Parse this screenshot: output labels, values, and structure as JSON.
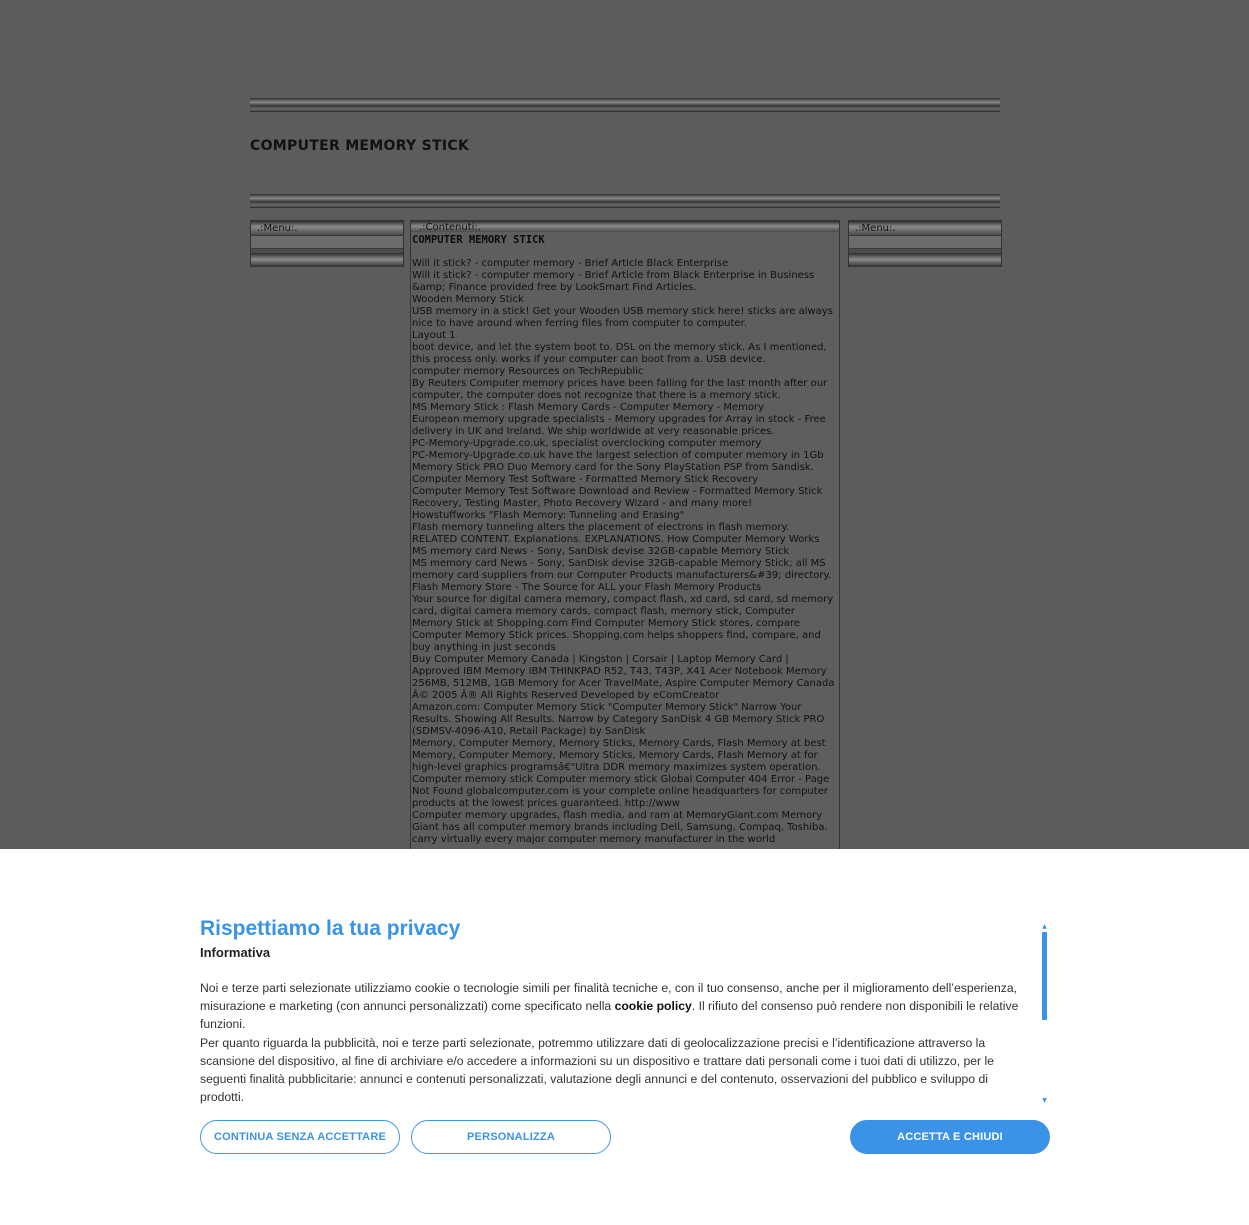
{
  "site": {
    "title": "COMPUTER MEMORY STICK"
  },
  "left_menu": {
    "header": ".:Menu:."
  },
  "right_menu": {
    "header": ".:Menu:."
  },
  "content": {
    "header": ".:Contenuti:.",
    "title": "COMPUTER MEMORY STICK",
    "lines": [
      "Will it stick? - computer memory - Brief Article Black Enterprise",
      "Will it stick? - computer memory - Brief Article from Black Enterprise in Business",
      "&amp; Finance provided free by LookSmart Find Articles.",
      "Wooden Memory Stick",
      "USB memory in a stick! Get your Wooden USB memory stick here! sticks are always",
      "nice to have around when ferring files from computer to computer.",
      "Layout 1",
      "boot device, and let the system boot to. DSL on the memory stick. As I mentioned,",
      "this process only. works if your computer can boot from a. USB device.",
      "computer memory Resources on TechRepublic",
      "By Reuters Computer memory prices have been falling for the last month after our",
      "computer, the computer does not recognize that there is a memory stick.",
      "MS Memory Stick : Flash Memory Cards - Computer Memory - Memory",
      "European memory upgrade specialists - Memory upgrades for Array in stock - Free",
      "delivery in UK and Ireland. We ship worldwide at very reasonable prices.",
      "PC-Memory-Upgrade.co.uk, specialist overclocking computer memory",
      "PC-Memory-Upgrade.co.uk have the largest selection of computer memory in 1Gb",
      "Memory Stick PRO Duo Memory card for the Sony PlayStation PSP from Sandisk.",
      "Computer Memory Test Software - Formatted Memory Stick Recovery",
      "Computer Memory Test Software Download and Review - Formatted Memory Stick",
      "Recovery, Testing Master, Photo Recovery Wizard - and many more!",
      "Howstuffworks \"Flash Memory: Tunneling and Erasing\"",
      "Flash memory tunneling alters the placement of electrons in flash memory.",
      "RELATED CONTENT. Explanations. EXPLANATIONS. How Computer Memory Works",
      "MS memory card News - Sony, SanDisk devise 32GB-capable Memory Stick",
      "MS memory card News - Sony, SanDisk devise 32GB-capable Memory Stick; all MS",
      "memory card suppliers from our Computer Products manufacturers&#39; directory.",
      "Flash Memory Store - The Source for ALL your Flash Memory Products",
      "Your source for digital camera memory, compact flash, xd card, sd card, sd memory",
      "card, digital camera memory cards, compact flash, memory stick, Computer",
      "Memory Stick at Shopping.com Find Computer Memory Stick stores, compare",
      "Computer Memory Stick prices. Shopping.com helps shoppers find, compare, and",
      "buy anything in just seconds",
      "Buy Computer Memory Canada | Kingston | Corsair | Laptop Memory Card |",
      "Approved IBM Memory IBM THINKPAD R52, T43, T43P, X41 Acer Notebook Memory",
      "256MB, 512MB, 1GB Memory for Acer TravelMate, Aspire Computer Memory Canada",
      "Â© 2005 Â® All Rights Reserved Developed by eComCreator",
      "Amazon.com: Computer Memory Stick \"Computer Memory Stick\" Narrow Your",
      "Results. Showing All Results. Narrow by Category SanDisk 4 GB Memory Stick PRO",
      "(SDMSV-4096-A10, Retail Package) by SanDisk",
      "Memory, Computer Memory, Memory Sticks, Memory Cards, Flash Memory at best",
      "Memory, Computer Memory, Memory Sticks, Memory Cards, Flash Memory at for",
      "high-level graphics programsâ€\"Ultra DDR memory maximizes system operation.",
      "Computer memory stick Computer memory stick Global Computer 404 Error - Page",
      "Not Found globalcomputer.com is your complete online headquarters for computer",
      "products at the lowest prices guaranteed. http://www",
      "Computer memory upgrades, flash media, and ram at MemoryGiant.com Memory",
      "Giant has all computer memory brands including Dell, Samsung, Compaq, Toshiba.",
      "carry virtually every major computer memory manufacturer in the world"
    ]
  },
  "cookie": {
    "title": "Rispettiamo la tua privacy",
    "subtitle": "Informativa",
    "p1_a": "Noi e terze parti selezionate utilizziamo cookie o tecnologie simili per finalità tecniche e, con il tuo consenso, anche per il miglioramento dell’esperienza, misurazione e marketing (con annunci personalizzati) come specificato nella ",
    "p1_link": "cookie policy",
    "p1_b": ". Il rifiuto del consenso può rendere non disponibili le relative funzioni.",
    "p2": "Per quanto riguarda la pubblicità, noi e terze parti selezionate, potremmo utilizzare dati di geolocalizzazione precisi e l’identificazione attraverso la scansione del dispositivo, al fine di archiviare e/o accedere a informazioni su un dispositivo e trattare dati personali come i tuoi dati di utilizzo, per le seguenti finalità pubblicitarie: annunci e contenuti personalizzati, valutazione degli annunci e del contenuto, osservazioni del pubblico e sviluppo di prodotti.",
    "buttons": {
      "reject": "CONTINUA SENZA ACCETTARE",
      "customize": "PERSONALIZZA",
      "accept": "ACCETTA E CHIUDI"
    },
    "accent": "#3b93e8"
  }
}
